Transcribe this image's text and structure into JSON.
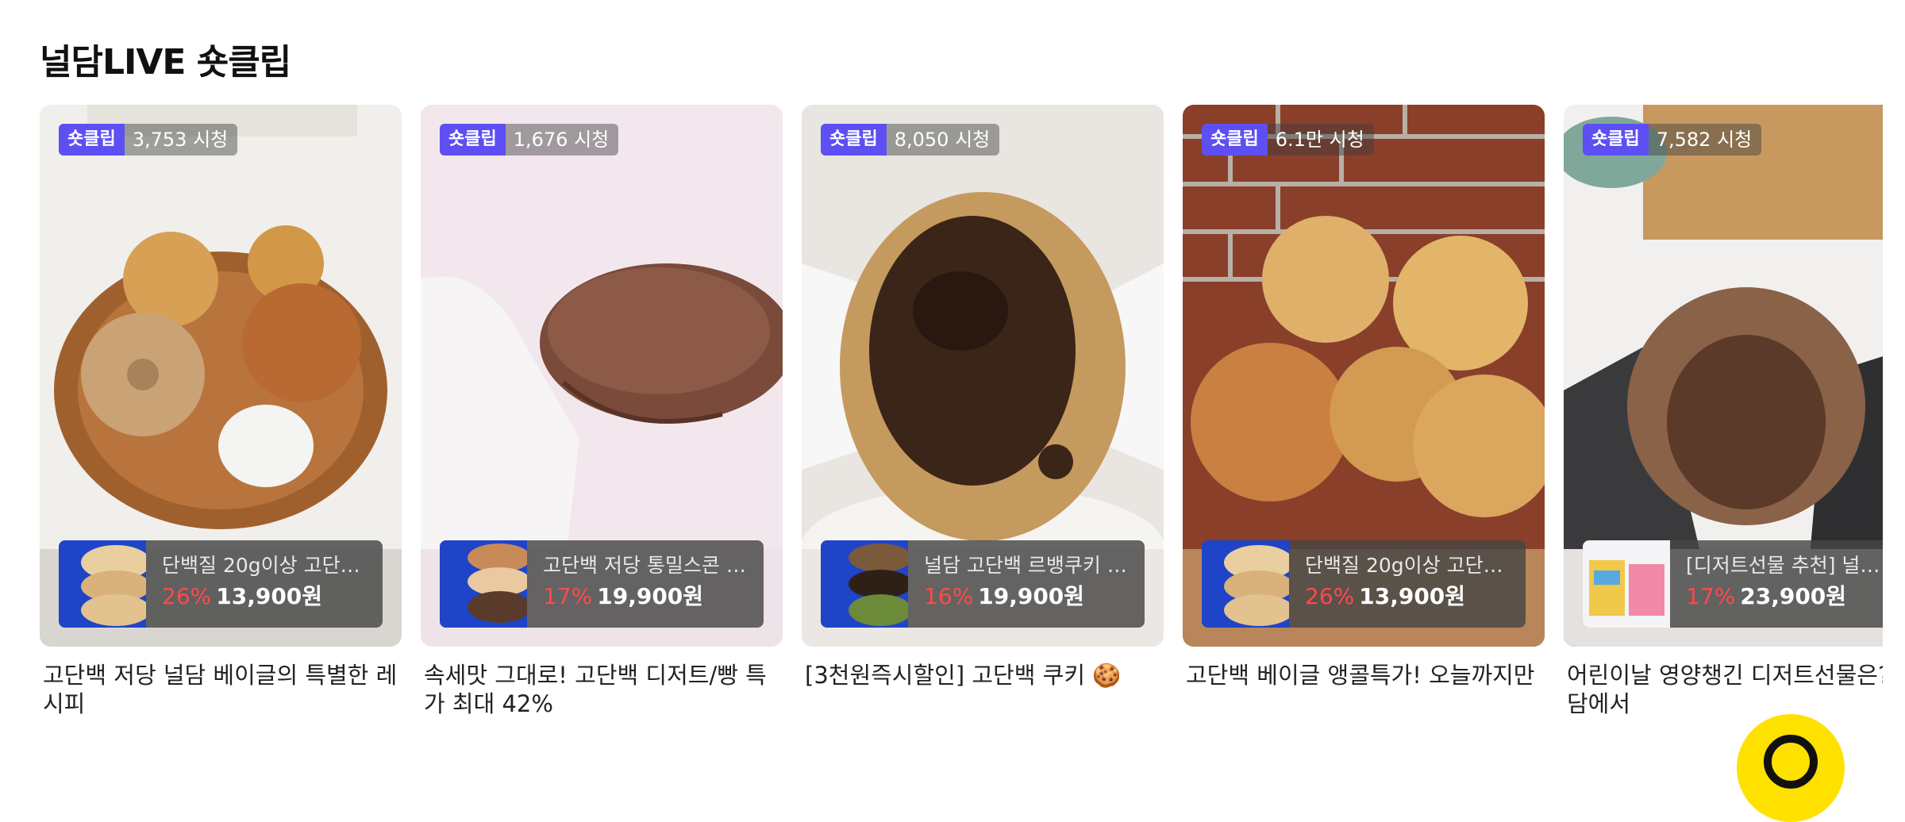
{
  "section": {
    "title": "널담LIVE 숏클립"
  },
  "shorts_badge_label": "숏클립",
  "colors": {
    "badge": "#5d4ff2",
    "discount": "#ff4a4a",
    "fab": "#ffe100"
  },
  "cards": [
    {
      "views": "3,753 시청",
      "image": "bagel-plate",
      "product": {
        "name": "단백질 20g이상 고단…",
        "discount": "26%",
        "price": "13,900원",
        "thumb": "bagel-product"
      },
      "caption": "고단백 저당 널담 베이글의 특별한 레시피"
    },
    {
      "views": "1,676 시청",
      "image": "chocolate-scone",
      "product": {
        "name": "고단백 저당 통밀스콘 …",
        "discount": "17%",
        "price": "19,900원",
        "thumb": "scone-product"
      },
      "caption": "속세맛 그대로! 고단백 디저트/빵 특가 최대 42%"
    },
    {
      "views": "8,050 시청",
      "image": "chocolate-cookie",
      "product": {
        "name": "널담 고단백 르뱅쿠키 …",
        "discount": "16%",
        "price": "19,900원",
        "thumb": "cookie-product"
      },
      "caption": "[3천원즉시할인] 고단백 쿠키 🍪"
    },
    {
      "views": "6.1만 시청",
      "image": "bagels-brick-wall",
      "product": {
        "name": "단백질 20g이상 고단…",
        "discount": "26%",
        "price": "13,900원",
        "thumb": "bagel-product"
      },
      "caption": "고단백 베이글 앵콜특가! 오늘까지만"
    },
    {
      "views": "7,582 시청",
      "image": "chocolate-macaron",
      "product": {
        "name": "[디저트선물 추천] 널담 …",
        "discount": "17%",
        "price": "23,900원",
        "thumb": "gift-product"
      },
      "caption": "어린이날 영양챙긴 디저트선물은? 널담에서"
    }
  ],
  "floating_button_icon": "chat-icon"
}
